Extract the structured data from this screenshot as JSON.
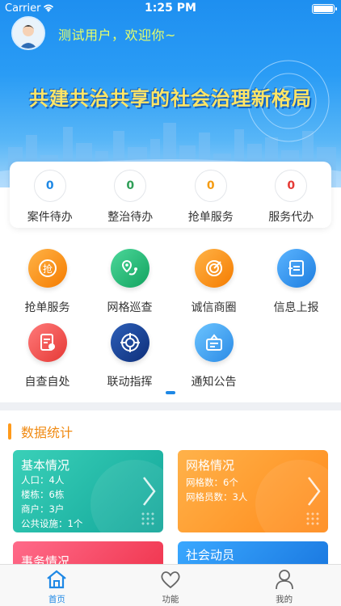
{
  "status_bar": {
    "carrier": "Carrier",
    "time": "1:25 PM"
  },
  "header": {
    "welcome": "测试用户，欢迎你~",
    "slogan": "共建共治共享的社会治理新格局"
  },
  "todo_stats": [
    {
      "label": "案件待办",
      "count": "0",
      "color": "#1e88e5"
    },
    {
      "label": "整治待办",
      "count": "0",
      "color": "#2e9e57"
    },
    {
      "label": "抢单服务",
      "count": "0",
      "color": "#f59b12"
    },
    {
      "label": "服务代办",
      "count": "0",
      "color": "#e53935"
    }
  ],
  "functions": [
    {
      "label": "抢单服务",
      "icon": "grab-order-icon"
    },
    {
      "label": "网格巡查",
      "icon": "map-route-icon"
    },
    {
      "label": "诚信商圈",
      "icon": "target-icon"
    },
    {
      "label": "信息上报",
      "icon": "report-upload-icon"
    },
    {
      "label": "自查自处",
      "icon": "self-check-icon"
    },
    {
      "label": "联动指挥",
      "icon": "crosshair-icon"
    },
    {
      "label": "通知公告",
      "icon": "notice-board-icon"
    }
  ],
  "data_section": {
    "title": "数据统计",
    "cards": [
      {
        "title": "基本情况",
        "lines": [
          "人口：4人",
          "楼栋：6栋",
          "商户：3户",
          "公共设施：1个"
        ]
      },
      {
        "title": "网格情况",
        "lines": [
          "网格数：6个",
          "网格员数：3人"
        ]
      },
      {
        "title": "事务情况",
        "lines": []
      },
      {
        "title": "社会动员",
        "lines": []
      }
    ]
  },
  "tabbar": {
    "items": [
      {
        "label": "首页"
      },
      {
        "label": "功能"
      },
      {
        "label": "我的"
      }
    ]
  }
}
